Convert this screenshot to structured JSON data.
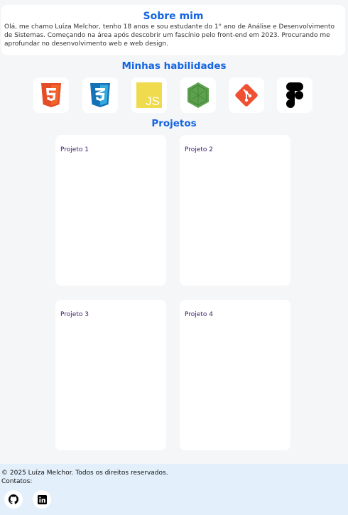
{
  "about": {
    "title": "Sobre mim",
    "text": "Olá, me chamo Luíza Melchor, tenho 18 anos e sou estudante do 1° ano de Análise e Desenvolvimento de Sistemas. Começando na área após descobrir um fascínio pelo front-end em 2023. Procurando me aprofundar no desenvolvimento web e web design."
  },
  "skills": {
    "title": "Minhas habilidades",
    "items": [
      {
        "icon": "html5-icon",
        "color": "#e44d26",
        "glyph": "5"
      },
      {
        "icon": "css3-icon",
        "color": "#1572b6",
        "glyph": "3"
      },
      {
        "icon": "javascript-icon",
        "color": "#f0db4f",
        "glyph": "JS"
      },
      {
        "icon": "nodejs-icon",
        "color": "#5fa04e"
      },
      {
        "icon": "git-icon",
        "color": "#f05032"
      },
      {
        "icon": "figma-icon",
        "color": "#000000"
      }
    ]
  },
  "projects": {
    "title": "Projetos",
    "items": [
      {
        "label": "Projeto 1"
      },
      {
        "label": "Projeto 2"
      },
      {
        "label": "Projeto 3"
      },
      {
        "label": "Projeto 4"
      }
    ]
  },
  "footer": {
    "copyright": "© 2025 Luíza Melchor. Todos os direitos reservados.",
    "contacts_label": "Contatos:",
    "links": [
      {
        "icon": "github-icon"
      },
      {
        "icon": "linkedin-icon"
      }
    ]
  },
  "colors": {
    "accent": "#1565e0",
    "background": "#f5f6f8",
    "footer": "#e3f0fb",
    "project_label": "#3a1a6b"
  }
}
